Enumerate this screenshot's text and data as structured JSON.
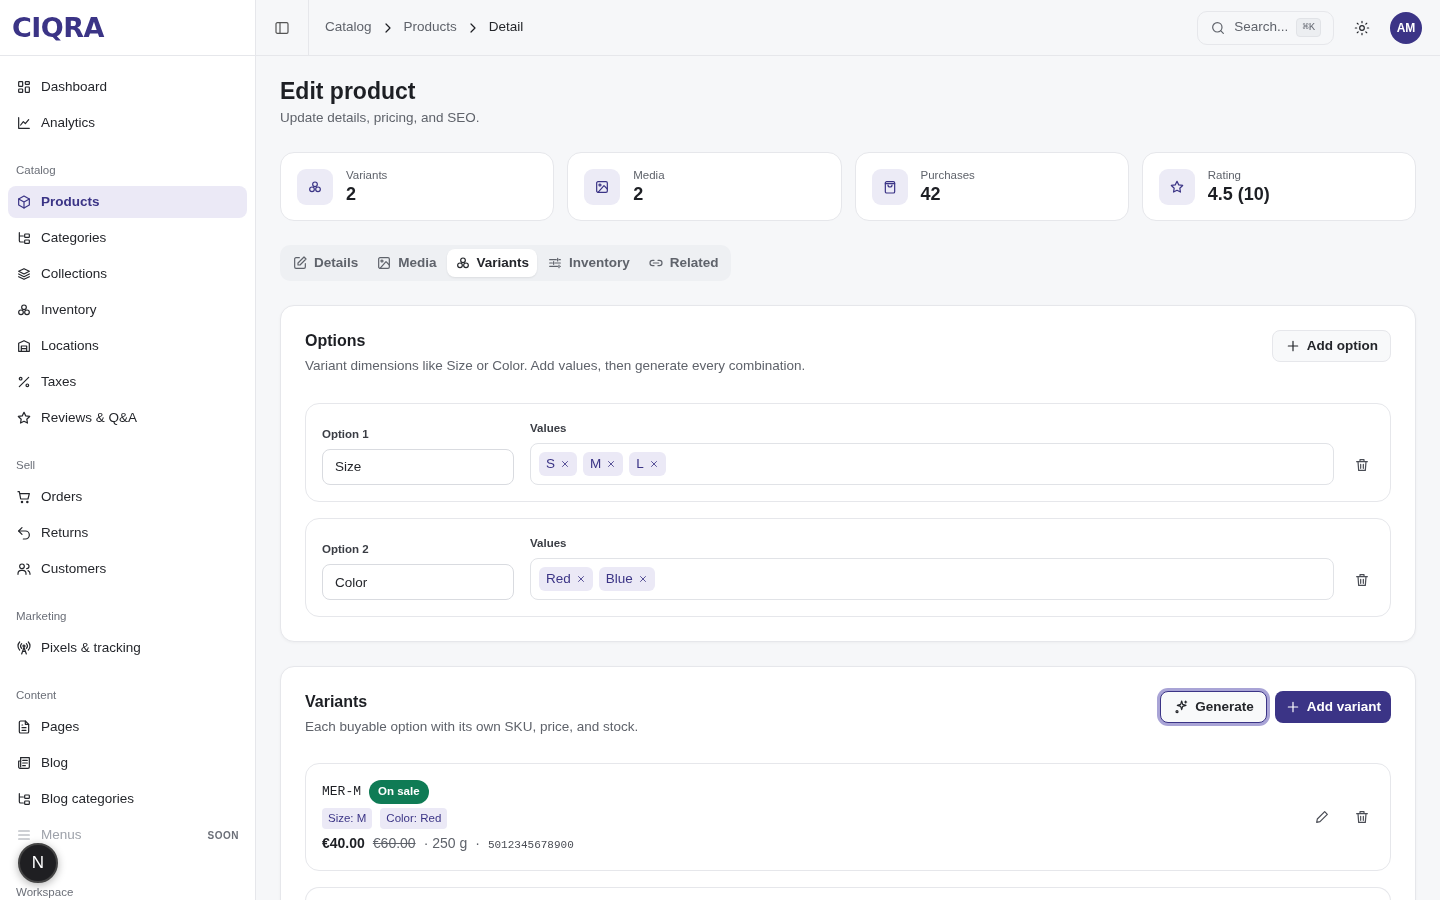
{
  "brand": "CIQRA",
  "sidebar": {
    "groups": [
      {
        "items": [
          {
            "label": "Dashboard",
            "selected": false
          },
          {
            "label": "Analytics",
            "selected": false
          }
        ]
      },
      {
        "label": "Catalog",
        "items": [
          {
            "label": "Products",
            "selected": true
          },
          {
            "label": "Categories",
            "selected": false
          },
          {
            "label": "Collections",
            "selected": false
          },
          {
            "label": "Inventory",
            "selected": false
          },
          {
            "label": "Locations",
            "selected": false
          },
          {
            "label": "Taxes",
            "selected": false
          },
          {
            "label": "Reviews & Q&A",
            "selected": false
          }
        ]
      },
      {
        "label": "Sell",
        "items": [
          {
            "label": "Orders",
            "selected": false
          },
          {
            "label": "Returns",
            "selected": false
          },
          {
            "label": "Customers",
            "selected": false
          }
        ]
      },
      {
        "label": "Marketing",
        "items": [
          {
            "label": "Pixels & tracking",
            "selected": false
          }
        ]
      },
      {
        "label": "Content",
        "items": [
          {
            "label": "Pages",
            "selected": false
          },
          {
            "label": "Blog",
            "selected": false
          },
          {
            "label": "Blog categories",
            "selected": false
          },
          {
            "label": "Menus",
            "selected": false,
            "disabled": true,
            "badge": "SOON"
          }
        ]
      },
      {
        "label": "Workspace"
      }
    ]
  },
  "dev_badge": "N",
  "breadcrumb": [
    "Catalog",
    "Products",
    "Detail"
  ],
  "search": {
    "placeholder": "Search...",
    "shortcut": "⌘K"
  },
  "avatar": "AM",
  "page": {
    "title": "Edit product",
    "subtitle": "Update details, pricing, and SEO."
  },
  "stats": [
    {
      "label": "Variants",
      "value": "2"
    },
    {
      "label": "Media",
      "value": "2"
    },
    {
      "label": "Purchases",
      "value": "42"
    },
    {
      "label": "Rating",
      "value": "4.5 (10)"
    }
  ],
  "tabs": [
    {
      "label": "Details",
      "selected": false
    },
    {
      "label": "Media",
      "selected": false
    },
    {
      "label": "Variants",
      "selected": true
    },
    {
      "label": "Inventory",
      "selected": false
    },
    {
      "label": "Related",
      "selected": false
    }
  ],
  "options": {
    "title": "Options",
    "subtitle": "Variant dimensions like Size or Color. Add values, then generate every combination.",
    "add_button": "Add option",
    "rows": [
      {
        "label": "Option 1",
        "name": "Size",
        "values_label": "Values",
        "values": [
          "S",
          "M",
          "L"
        ]
      },
      {
        "label": "Option 2",
        "name": "Color",
        "values_label": "Values",
        "values": [
          "Red",
          "Blue"
        ]
      }
    ]
  },
  "variants": {
    "title": "Variants",
    "subtitle": "Each buyable option with its own SKU, price, and stock.",
    "generate_button": {
      "label": "Generate",
      "focused": true
    },
    "add_button": "Add variant",
    "items": [
      {
        "sku": "MER-M",
        "badge": "On sale",
        "attributes": [
          "Size: M",
          "Color: Red"
        ],
        "price": "€40.00",
        "compare_price": "€60.00",
        "weight": "· 250 g",
        "separator": "·",
        "barcode": "5012345678900"
      }
    ]
  }
}
